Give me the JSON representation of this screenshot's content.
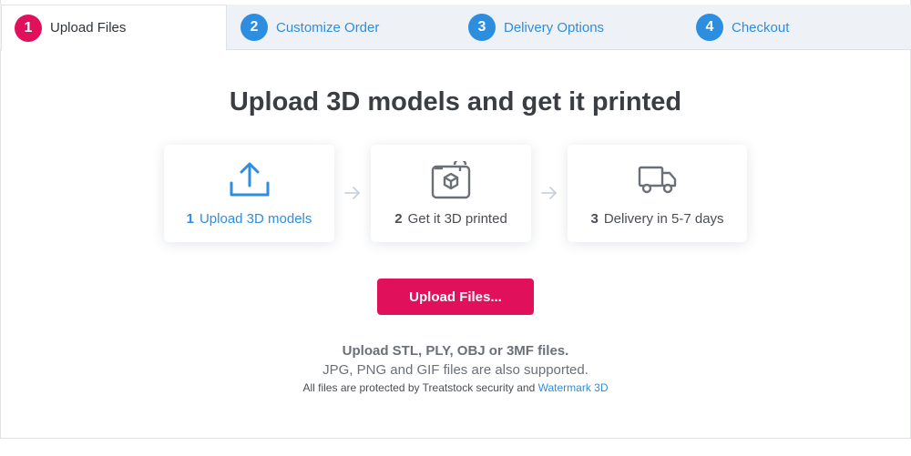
{
  "steps": [
    {
      "number": "1",
      "label": "Upload Files",
      "active": true
    },
    {
      "number": "2",
      "label": "Customize Order",
      "active": false
    },
    {
      "number": "3",
      "label": "Delivery Options",
      "active": false
    },
    {
      "number": "4",
      "label": "Checkout",
      "active": false
    }
  ],
  "main": {
    "title": "Upload 3D models and get it printed",
    "cards": [
      {
        "number": "1",
        "label": "Upload 3D models",
        "icon": "upload-icon"
      },
      {
        "number": "2",
        "label": "Get it 3D printed",
        "icon": "3d-printer-icon"
      },
      {
        "number": "3",
        "label": "Delivery in 5-7 days",
        "icon": "truck-icon"
      }
    ],
    "upload_button": "Upload Files...",
    "formats_text": "Upload STL, PLY, OBJ or 3MF files.",
    "supported_text": "JPG, PNG and GIF files are also supported.",
    "protection_text": "All files are protected by Treatstock security and",
    "protection_link": "Watermark 3D"
  },
  "colors": {
    "accent": "#e0105a",
    "link_blue": "#2d8ee0",
    "tab_bg": "#eef2f7"
  }
}
